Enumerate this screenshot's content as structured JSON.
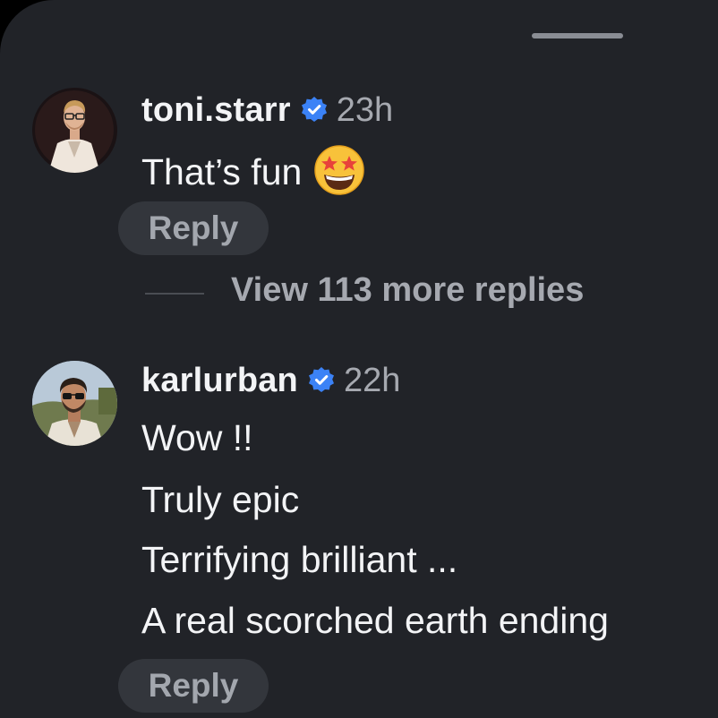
{
  "comments": [
    {
      "username": "toni.starr",
      "verified_icon": "verified-badge-icon",
      "time": "23h",
      "lines": [
        "That’s fun"
      ],
      "emoji": "star-struck-emoji",
      "reply_label": "Reply",
      "avatar_icon": "avatar-photo"
    },
    {
      "username": "karlurban",
      "verified_icon": "verified-badge-icon",
      "time": "22h",
      "lines": [
        "Wow !!",
        "Truly epic",
        "Terrifying brilliant ...",
        "A real scorched earth ending"
      ],
      "reply_label": "Reply",
      "avatar_icon": "avatar-photo"
    }
  ],
  "thread": {
    "view_more_label": "View 113 more replies"
  },
  "colors": {
    "background": "#212328",
    "verified": "#3b82f6",
    "text_primary": "#f3f4f6",
    "text_secondary": "#a6a9b0",
    "pill": "#33363c"
  }
}
